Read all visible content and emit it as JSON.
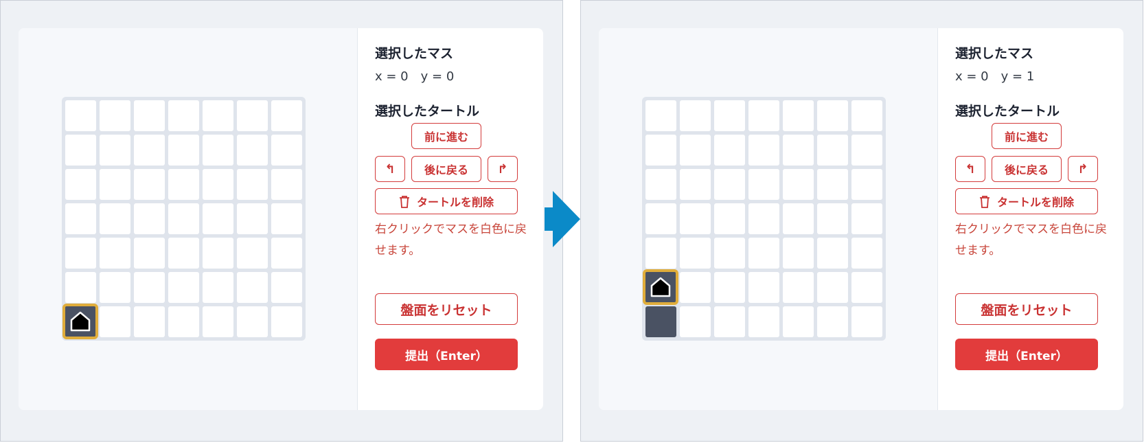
{
  "screens": [
    {
      "selected_cell_heading": "選択したマス",
      "coord_x": "x = 0",
      "coord_y": "y = 0",
      "selected_turtle_heading": "選択したタートル",
      "forward_label": "前に進む",
      "turn_left_symbol": "↰",
      "back_label": "後に戻る",
      "turn_right_symbol": "↱",
      "delete_label": "タートルを削除",
      "hint_text": "右クリックでマスを白色に戻せます。",
      "reset_label": "盤面をリセット",
      "submit_label": "提出（Enter）",
      "turtle_cell": {
        "x": 0,
        "y": 0
      },
      "filled_cells": []
    },
    {
      "selected_cell_heading": "選択したマス",
      "coord_x": "x = 0",
      "coord_y": "y = 1",
      "selected_turtle_heading": "選択したタートル",
      "forward_label": "前に進む",
      "turn_left_symbol": "↰",
      "back_label": "後に戻る",
      "turn_right_symbol": "↱",
      "delete_label": "タートルを削除",
      "hint_text": "右クリックでマスを白色に戻せます。",
      "reset_label": "盤面をリセット",
      "submit_label": "提出（Enter）",
      "turtle_cell": {
        "x": 0,
        "y": 1
      },
      "filled_cells": [
        {
          "x": 0,
          "y": 0
        }
      ]
    }
  ],
  "grid": {
    "columns": 7,
    "rows": 7
  },
  "colors": {
    "accent": "#e23c3c",
    "filled_cell": "#4a5263",
    "turtle_highlight": "#e0ad3b",
    "arrow": "#0b8ac8"
  },
  "icons": {
    "turtle": "turtle-icon",
    "trash": "trash-icon",
    "arrow": "right-arrow-icon"
  }
}
